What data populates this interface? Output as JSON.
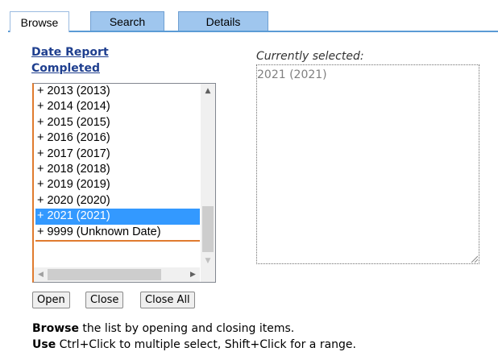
{
  "tabs": [
    {
      "label": "Browse",
      "active": true
    },
    {
      "label": "Search",
      "active": false
    },
    {
      "label": "Details",
      "active": false
    }
  ],
  "heading": {
    "line1": "Date Report",
    "line2": "Completed"
  },
  "list": {
    "items": [
      "+ 2013  (2013)",
      "+ 2014  (2014)",
      "+ 2015  (2015)",
      "+ 2016  (2016)",
      "+ 2017  (2017)",
      "+ 2018  (2018)",
      "+ 2019  (2019)",
      "+ 2020  (2020)",
      "+ 2021  (2021)",
      "+ 9999  (Unknown Date)"
    ],
    "selected_index": 8
  },
  "buttons": {
    "open": "Open",
    "close": "Close",
    "close_all": "Close All"
  },
  "currently_selected": {
    "label": "Currently selected:",
    "value": "2021 (2021)"
  },
  "help": {
    "line1_bold": "Browse",
    "line1_rest": " the list by opening and closing items.",
    "line2_bold": "Use",
    "line2_rest": " Ctrl+Click to multiple select, Shift+Click for a range."
  },
  "colors": {
    "accent_blue": "#5b9bd5",
    "selection": "#3399ff",
    "heading_link": "#1f3f8f",
    "focus_orange": "#e07b2f"
  }
}
